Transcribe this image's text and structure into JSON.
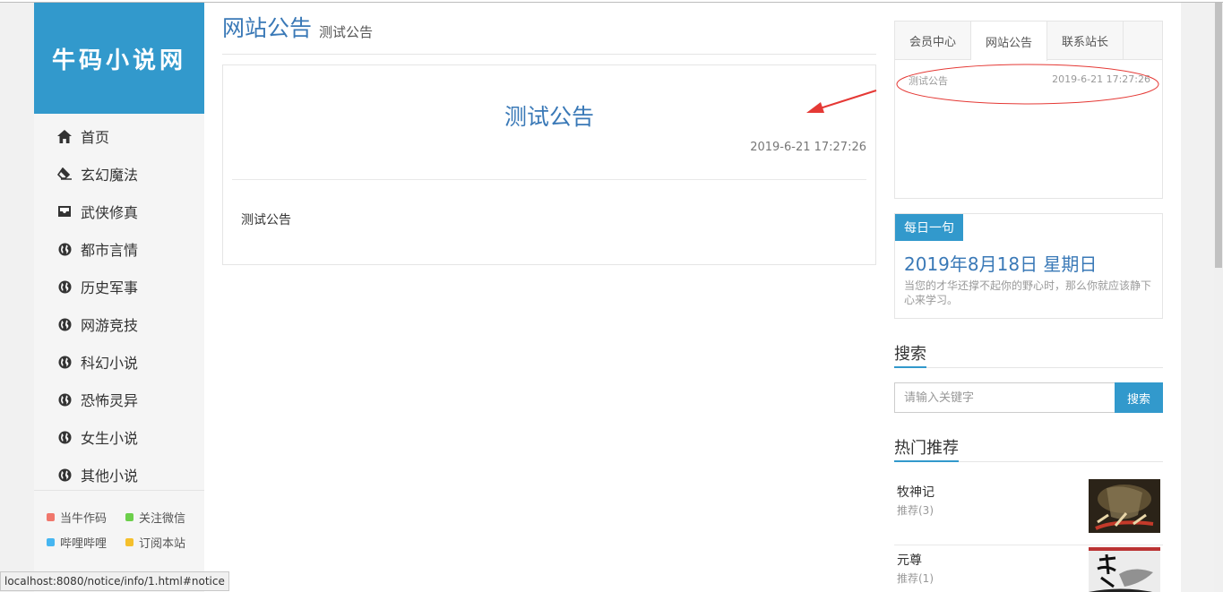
{
  "sidebar": {
    "logo": "牛码小说网",
    "nav": [
      {
        "label": "首页",
        "icon": "home-icon"
      },
      {
        "label": "玄幻魔法",
        "icon": "eraser-icon"
      },
      {
        "label": "武侠修真",
        "icon": "inbox-icon"
      },
      {
        "label": "都市言情",
        "icon": "globe-icon"
      },
      {
        "label": "历史军事",
        "icon": "globe-icon"
      },
      {
        "label": "网游竞技",
        "icon": "globe-icon"
      },
      {
        "label": "科幻小说",
        "icon": "globe-icon"
      },
      {
        "label": "恐怖灵异",
        "icon": "globe-icon"
      },
      {
        "label": "女生小说",
        "icon": "globe-icon"
      },
      {
        "label": "其他小说",
        "icon": "globe-icon"
      }
    ],
    "links": [
      {
        "label": "当牛作码",
        "color": "#f0776c"
      },
      {
        "label": "关注微信",
        "color": "#6ccf4b"
      },
      {
        "label": "哔哩哔哩",
        "color": "#46b6f1"
      },
      {
        "label": "订阅本站",
        "color": "#f5c02c"
      }
    ]
  },
  "main": {
    "title": "网站公告",
    "subtitle": "测试公告",
    "notice": {
      "title": "测试公告",
      "time": "2019-6-21 17:27:26",
      "body": "测试公告"
    }
  },
  "right": {
    "tabs": [
      {
        "label": "会员中心",
        "active": false
      },
      {
        "label": "网站公告",
        "active": true
      },
      {
        "label": "联系站长",
        "active": false
      }
    ],
    "notice_item": {
      "title": "测试公告",
      "time": "2019-6-21 17:27:26"
    },
    "daily": {
      "badge": "每日一句",
      "date": "2019年8月18日 星期日",
      "text": "当您的才华还撑不起你的野心时，那么你就应该静下心来学习。"
    },
    "search": {
      "heading": "搜索",
      "placeholder": "请输入关键字",
      "button": "搜索"
    },
    "hot": {
      "heading": "热门推荐",
      "items": [
        {
          "name": "牧神记",
          "rec": "推荐(3)"
        },
        {
          "name": "元尊",
          "rec": "推荐(1)"
        }
      ]
    }
  },
  "status_url": "localhost:8080/notice/info/1.html#notice",
  "colors": {
    "brand": "#3299cc",
    "title": "#3a79b7",
    "annotation": "#e53935"
  }
}
